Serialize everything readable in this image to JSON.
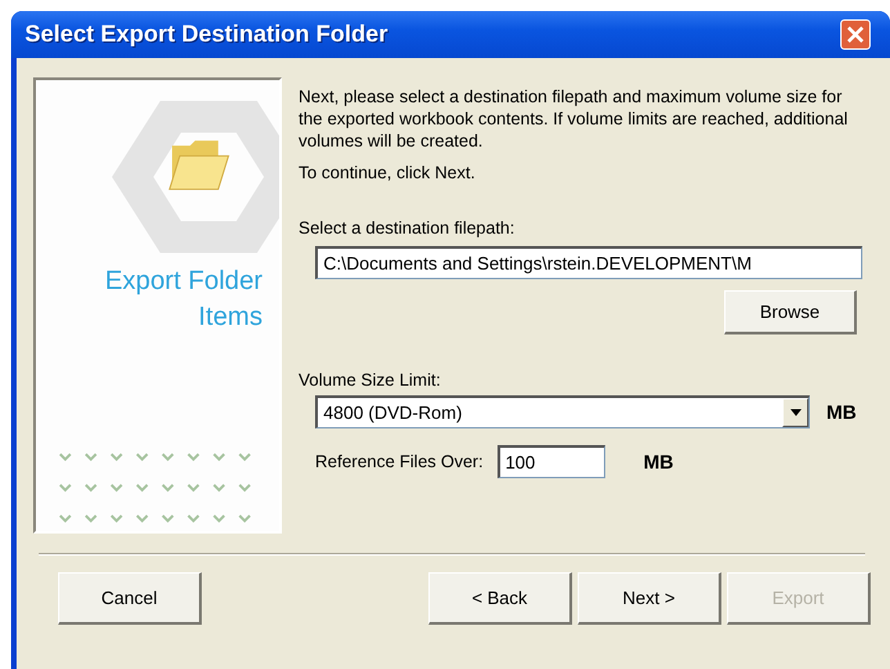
{
  "window": {
    "title": "Select Export Destination Folder"
  },
  "side_panel": {
    "heading": "Export Folder Items"
  },
  "intro": "Next, please select a destination filepath and maximum volume size for the exported workbook contents.  If volume limits are reached, additional volumes will be created.",
  "continue_note": "To continue, click Next.",
  "filepath": {
    "label": "Select a destination filepath:",
    "value": "C:\\Documents and Settings\\rstein.DEVELOPMENT\\M",
    "browse": "Browse"
  },
  "volume": {
    "label": "Volume Size Limit:",
    "value": "4800 (DVD-Rom)",
    "unit": "MB"
  },
  "reference": {
    "label": "Reference Files Over:",
    "value": "100",
    "unit": "MB"
  },
  "buttons": [
    {
      "label": "Cancel",
      "disabled": false
    },
    {
      "label": "< Back",
      "disabled": false
    },
    {
      "label": "Next >",
      "disabled": false
    },
    {
      "label": "Export",
      "disabled": true
    }
  ]
}
